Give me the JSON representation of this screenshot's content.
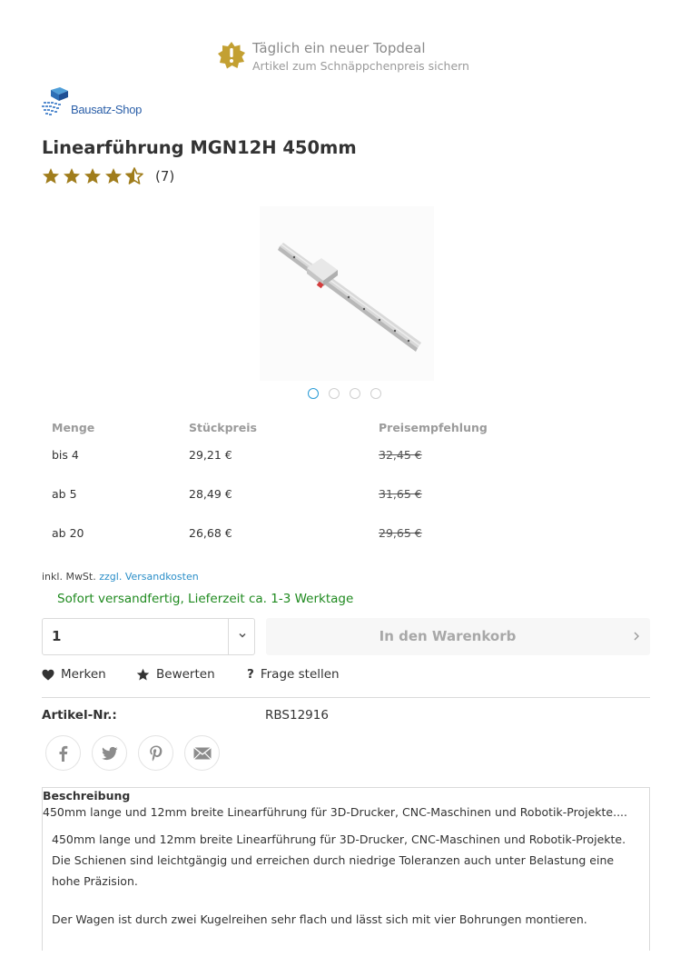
{
  "topdeal": {
    "title": "Täglich ein neuer Topdeal",
    "subtitle": "Artikel zum Schnäppchenpreis sichern",
    "icon": "exclamation-badge-icon"
  },
  "logo": {
    "text": "Bausatz-Shop"
  },
  "product": {
    "title": "Linearführung MGN12H 450mm",
    "rating": {
      "stars": 4.5,
      "max": 5,
      "count_label": "(7)"
    },
    "gallery": {
      "slides": 4,
      "active": 1
    }
  },
  "price_table": {
    "headers": [
      "Menge",
      "Stückpreis",
      "Preisempfehlung"
    ],
    "rows": [
      {
        "qty": "bis 4",
        "price": "29,21 €",
        "rrp": "32,45 €"
      },
      {
        "qty": "ab 5",
        "price": "28,49 €",
        "rrp": "31,65 €"
      },
      {
        "qty": "ab 20",
        "price": "26,68 €",
        "rrp": "29,65 €"
      }
    ]
  },
  "tax": {
    "text": "inkl. MwSt.",
    "shipping_link": "zzgl. Versandkosten"
  },
  "delivery": "Sofort versandfertig, Lieferzeit ca. 1-3 Werktage",
  "buy": {
    "quantity": "1",
    "cart_label": "In den Warenkorb"
  },
  "actions": {
    "remember": "Merken",
    "review": "Bewerten",
    "ask": "Frage stellen"
  },
  "article": {
    "label": "Artikel-Nr.:",
    "value": "RBS12916"
  },
  "share": [
    "facebook-icon",
    "twitter-icon",
    "pinterest-icon",
    "mail-icon"
  ],
  "description": {
    "title": "Beschreibung",
    "summary": "450mm lange und 12mm breite Linearführung für 3D-Drucker, CNC-Maschinen und Robotik-Projekte....",
    "paragraph1": "450mm lange und 12mm breite Linearführung für 3D-Drucker, CNC-Maschinen und Robotik-Projekte. Die Schienen sind leichtgängig und erreichen durch niedrige Toleranzen auch unter Belastung eine hohe Präzision.",
    "paragraph2": "Der Wagen ist durch zwei Kugelreihen sehr flach und lässt sich mit vier Bohrungen montieren."
  },
  "colors": {
    "star": "#a07d1c",
    "link": "#2a8ec8",
    "delivery": "#1f8a1f",
    "badge": "#c3a032"
  }
}
